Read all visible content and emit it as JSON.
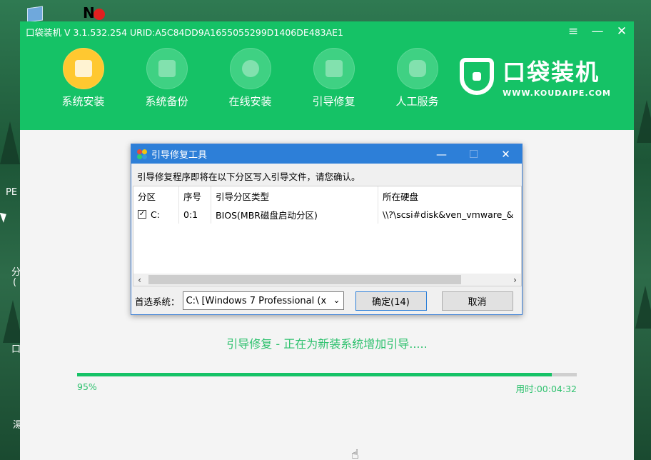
{
  "desktop": {
    "np_label": "N",
    "side_labels": [
      "PE",
      "分",
      "(",
      "口",
      "湯"
    ]
  },
  "window": {
    "title": "口袋装机 V 3.1.532.254 URID:A5C84DD9A1655055299D1406DE483AE1",
    "menu_icon": "menu-icon",
    "min_symbol": "—",
    "close_symbol": "✕"
  },
  "toolbar": {
    "items": [
      {
        "label": "系统安装",
        "icon": "system-install-icon",
        "active": true
      },
      {
        "label": "系统备份",
        "icon": "system-backup-icon",
        "active": false
      },
      {
        "label": "在线安装",
        "icon": "download-icon",
        "active": false
      },
      {
        "label": "引导修复",
        "icon": "toolbox-icon",
        "active": false
      },
      {
        "label": "人工服务",
        "icon": "chat-icon",
        "active": false
      }
    ]
  },
  "brand": {
    "name": "口袋装机",
    "url": "WWW.KOUDAIPE.COM"
  },
  "dialog": {
    "title": "引导修复工具",
    "minimize": "—",
    "maximize": "☐",
    "close": "✕",
    "message": "引导修复程序即将在以下分区写入引导文件，请您确认。",
    "columns": [
      "分区",
      "序号",
      "引导分区类型",
      "所在硬盘"
    ],
    "rows": [
      {
        "checked": true,
        "partition": "C:",
        "index": "0:1",
        "type": "BIOS(MBR磁盘启动分区)",
        "disk": "\\\\?\\scsi#disk&ven_vmware_&"
      }
    ],
    "preferred_label": "首选系统：",
    "preferred_value": "C:\\ [Windows 7 Professional (x",
    "ok_label": "确定(14)",
    "cancel_label": "取消"
  },
  "progress": {
    "status_text": "引导修复 - 正在为新装系统增加引导.....",
    "percent_label": "95%",
    "percent_value": 95,
    "elapsed_label": "用时:00:04:32"
  },
  "colors": {
    "brand_green": "#15c266",
    "active_yellow": "#ffc830",
    "dialog_blue": "#2d7fd8"
  }
}
